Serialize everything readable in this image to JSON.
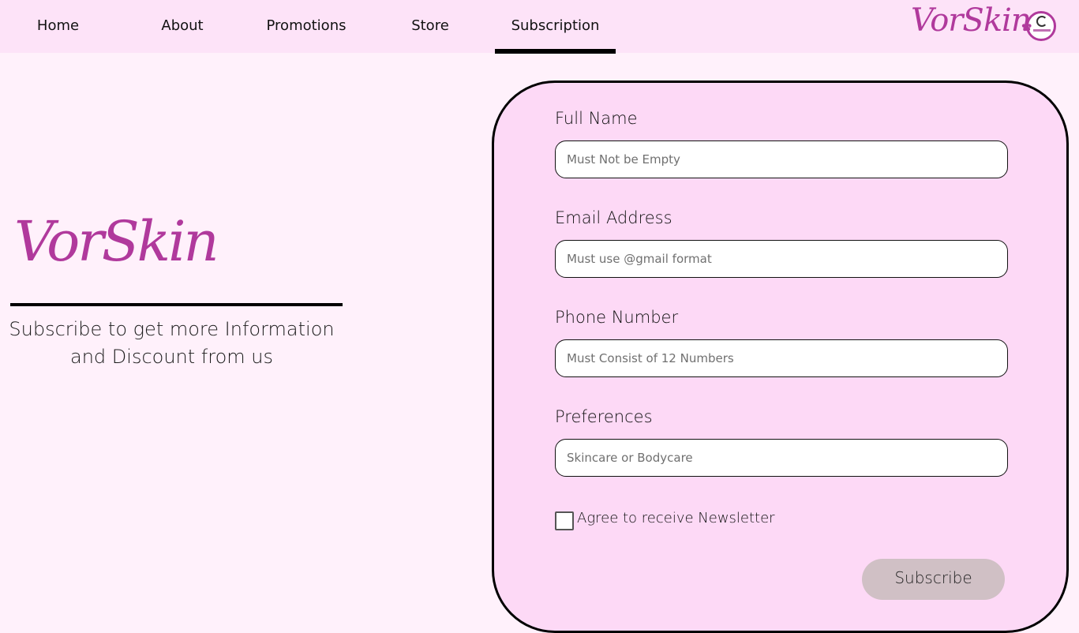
{
  "nav": {
    "items": [
      {
        "label": "Home"
      },
      {
        "label": "About"
      },
      {
        "label": "Promotions"
      },
      {
        "label": "Store"
      },
      {
        "label": "Subscription"
      }
    ],
    "active": "Subscription",
    "brand": "VorSkin",
    "logo_icon": "vorskin-logo-icon"
  },
  "hero": {
    "brand": "VorSkin",
    "tagline_line1": "Subscribe to get more Information",
    "tagline_line2": "and Discount from us"
  },
  "form": {
    "full_name": {
      "label": "Full Name",
      "placeholder": "Must Not be Empty",
      "value": ""
    },
    "email": {
      "label": "Email Address",
      "placeholder": "Must use @gmail format",
      "value": ""
    },
    "phone": {
      "label": "Phone Number",
      "placeholder": "Must Consist of 12 Numbers",
      "value": ""
    },
    "preferences": {
      "label": "Preferences",
      "placeholder": "Skincare or Bodycare",
      "value": ""
    },
    "newsletter": {
      "label": "Agree to receive Newsletter",
      "checked": false
    },
    "submit_label": "Subscribe"
  },
  "colors": {
    "brand": "#b0399c",
    "nav_bg": "#fde3f8",
    "page_bg": "#fff1fb",
    "card_bg": "#fdd9f6",
    "button_bg": "#d0c0c5"
  }
}
